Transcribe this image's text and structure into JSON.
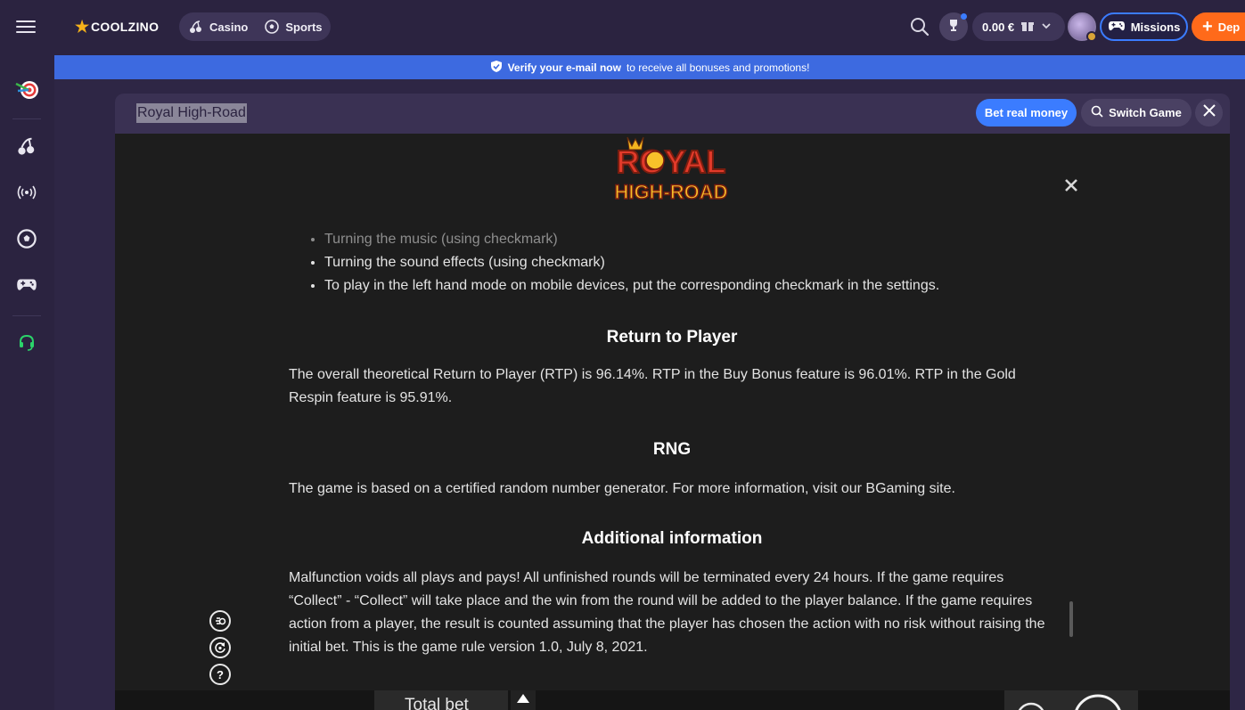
{
  "header": {
    "logo_text": "COOLZINO",
    "nav": [
      {
        "label": "Casino",
        "icon": "cherry-icon"
      },
      {
        "label": "Sports",
        "icon": "soccer-ball-icon"
      }
    ],
    "balance": "0.00 €",
    "missions_label": "Missions",
    "deposit_label": "Dep"
  },
  "sidebar": {
    "items": [
      {
        "name": "promotions",
        "icon": "target-darts-icon"
      },
      {
        "name": "casino",
        "icon": "cherry-icon"
      },
      {
        "name": "live",
        "icon": "broadcast-icon"
      },
      {
        "name": "sports",
        "icon": "soccer-ball-icon"
      },
      {
        "name": "games",
        "icon": "gamepad-icon"
      },
      {
        "name": "support",
        "icon": "headset-icon"
      }
    ]
  },
  "banner": {
    "bold": "Verify your e-mail now",
    "rest": "to receive all bonuses and promotions!"
  },
  "game": {
    "title": "Royal High-Road",
    "bet_real_label": "Bet real money",
    "switch_label": "Switch Game",
    "logo_line1": "ROYAL",
    "logo_line2": "HIGH-ROAD"
  },
  "rules": {
    "list": [
      "Turning the music (using checkmark)",
      "Turning the sound effects (using checkmark)",
      "To play in the left hand mode on mobile devices, put the corresponding checkmark in the settings."
    ],
    "rtp_heading": "Return to Player",
    "rtp_text": "The overall theoretical Return to Player (RTP) is 96.14%. RTP in the Buy Bonus feature is 96.01%. RTP in the Gold Respin feature is 95.91%.",
    "rng_heading": "RNG",
    "rng_text": "The game is based on a certified random number generator. For more information, visit our BGaming site.",
    "info_heading": "Additional information",
    "info_text": "Malfunction voids all plays and pays! All unfinished rounds will be terminated every 24 hours. If the game requires “Collect” - “Collect” will take place and the win from the round will be added to the player balance. If the game requires action from a player, the result is counted assuming that the player has chosen the action with no risk without raising the initial bet. This is the game rule version 1.0, July 8, 2021."
  },
  "controls": {
    "help_glyph": "?",
    "info_glyph": "i",
    "total_bet_label": "Total bet"
  },
  "colors": {
    "accent_blue": "#3b7cff",
    "deposit_orange": "#ff6a1a",
    "banner_blue": "#3d6ae0",
    "support_green": "#2bd46a"
  }
}
